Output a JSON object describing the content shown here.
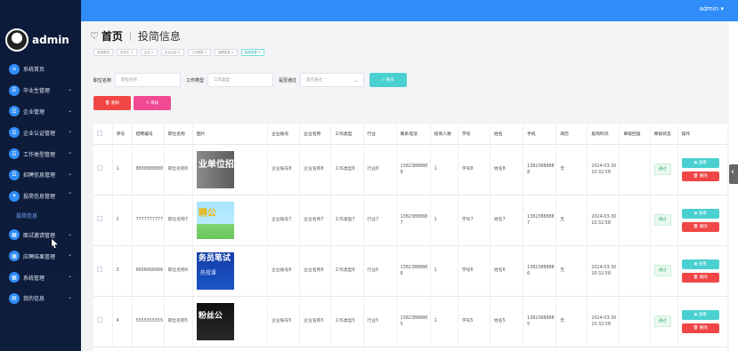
{
  "topbar": {
    "user_label": "admin ▾"
  },
  "brand": {
    "name": "admin"
  },
  "menu": {
    "items": [
      {
        "label": "系统首页",
        "icon": "home-icon"
      },
      {
        "label": "毕业生管理",
        "icon": "user-icon",
        "chevron": "⌄"
      },
      {
        "label": "企业管理",
        "icon": "building-icon",
        "chevron": "⌄"
      },
      {
        "label": "企业认证管理",
        "icon": "badge-icon",
        "chevron": "⌄"
      },
      {
        "label": "工作类型管理",
        "icon": "briefcase-icon",
        "chevron": "⌄"
      },
      {
        "label": "招聘信息管理",
        "icon": "document-icon",
        "chevron": "⌄"
      },
      {
        "label": "投简信息管理",
        "icon": "send-icon",
        "chevron": "⌃"
      }
    ],
    "submenu": {
      "label": "投简信息"
    },
    "items_after": [
      {
        "label": "面试邀请管理",
        "icon": "grid-icon",
        "chevron": "⌄"
      },
      {
        "label": "应聘结果管理",
        "icon": "check-icon",
        "chevron": "⌄"
      },
      {
        "label": "系统管理",
        "icon": "settings-icon",
        "chevron": "⌄"
      },
      {
        "label": "我的信息",
        "icon": "profile-icon",
        "chevron": "⌄"
      }
    ]
  },
  "breadcrumb": {
    "home": "首页",
    "current": "投简信息"
  },
  "tabs": [
    {
      "label": "系统首页"
    },
    {
      "label": "毕业生 ×"
    },
    {
      "label": "企业 ×"
    },
    {
      "label": "企业认证 ×"
    },
    {
      "label": "工作类型 ×"
    },
    {
      "label": "招聘信息 ×"
    },
    {
      "label": "投简信息 ×"
    }
  ],
  "search": {
    "job_name_label": "职位名称",
    "job_name_placeholder": "职位名称",
    "job_type_label": "工作类型",
    "job_type_placeholder": "工作类型",
    "passed_label": "是否通过",
    "passed_placeholder": "是否通过",
    "search_button": "查询"
  },
  "toolbar": {
    "delete_label": "删除",
    "audit_label": "审核"
  },
  "table": {
    "headers": [
      "",
      "序号",
      "招聘编号",
      "职位名称",
      "图片",
      "企业账号",
      "企业名称",
      "工作类型",
      "行业",
      "联系电话",
      "投简人数",
      "学号",
      "姓名",
      "手机",
      "简历",
      "投简时间",
      "审核回复",
      "审核状态",
      "操作"
    ],
    "rows": [
      {
        "index": "1",
        "code": "8888888888",
        "job": "职位名称8",
        "image_text": "业单位招",
        "account": "企业账号8",
        "company": "企业名称8",
        "type": "工作类型8",
        "industry": "行业8",
        "phone": "13823888888",
        "count": "1",
        "student_id": "学号8",
        "name": "姓名8",
        "mobile": "13823888888",
        "resume": "无",
        "time": "2024-03-30 10:32:58",
        "reply": "",
        "status": "通过"
      },
      {
        "index": "2",
        "code": "7777777777",
        "job": "职位名称7",
        "image_text": "聘公",
        "account": "企业账号7",
        "company": "企业名称7",
        "type": "工作类型7",
        "industry": "行业7",
        "phone": "13823888887",
        "count": "1",
        "student_id": "学号7",
        "name": "姓名7",
        "mobile": "13823888887",
        "resume": "无",
        "time": "2024-03-30 10:32:58",
        "reply": "",
        "status": "通过"
      },
      {
        "index": "3",
        "code": "6666666666",
        "job": "职位名称6",
        "image_text": "务员笔试",
        "image_sub": "热授课",
        "account": "企业账号6",
        "company": "企业名称6",
        "type": "工作类型6",
        "industry": "行业6",
        "phone": "13823888886",
        "count": "1",
        "student_id": "学号6",
        "name": "姓名6",
        "mobile": "13823888886",
        "resume": "无",
        "time": "2024-03-30 10:32:58",
        "reply": "",
        "status": "通过"
      },
      {
        "index": "4",
        "code": "5555555555",
        "job": "职位名称5",
        "image_text": "粉丝公",
        "account": "企业账号5",
        "company": "企业名称5",
        "type": "工作类型5",
        "industry": "行业5",
        "phone": "13823888885",
        "count": "1",
        "student_id": "学号5",
        "name": "姓名5",
        "mobile": "13823888885",
        "resume": "无",
        "time": "2024-03-30 10:32:58",
        "reply": "",
        "status": "通过"
      }
    ],
    "view_label": "查看",
    "delete_label": "删除"
  }
}
